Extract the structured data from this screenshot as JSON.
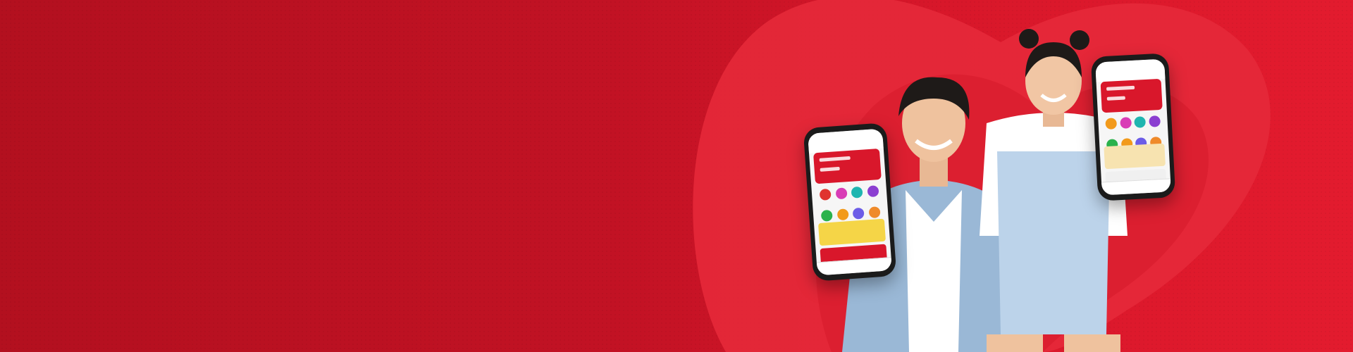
{
  "banner": {
    "background_colors": [
      "#b3101f",
      "#c21224",
      "#e31b2e"
    ],
    "heart_color": "#e82a3a",
    "heart_inner_color": "#de2031"
  },
  "phones": [
    {
      "tiles": [
        "#e0342f",
        "#d93cb6",
        "#1fb5b0",
        "#8b3fd1",
        "#2bb24c",
        "#f29a1b",
        "#6c5ce7",
        "#ef8a2a"
      ],
      "promo_colors": [
        "#f5d547",
        "#d9172b"
      ]
    },
    {
      "tiles": [
        "#f29a1b",
        "#d93cb6",
        "#1fb5b0",
        "#8b3fd1",
        "#2bb24c",
        "#f29a1b",
        "#6c5ce7",
        "#ef8a2a"
      ],
      "promo_colors": [
        "#f7e3b0",
        "#f0f0f0"
      ]
    }
  ]
}
